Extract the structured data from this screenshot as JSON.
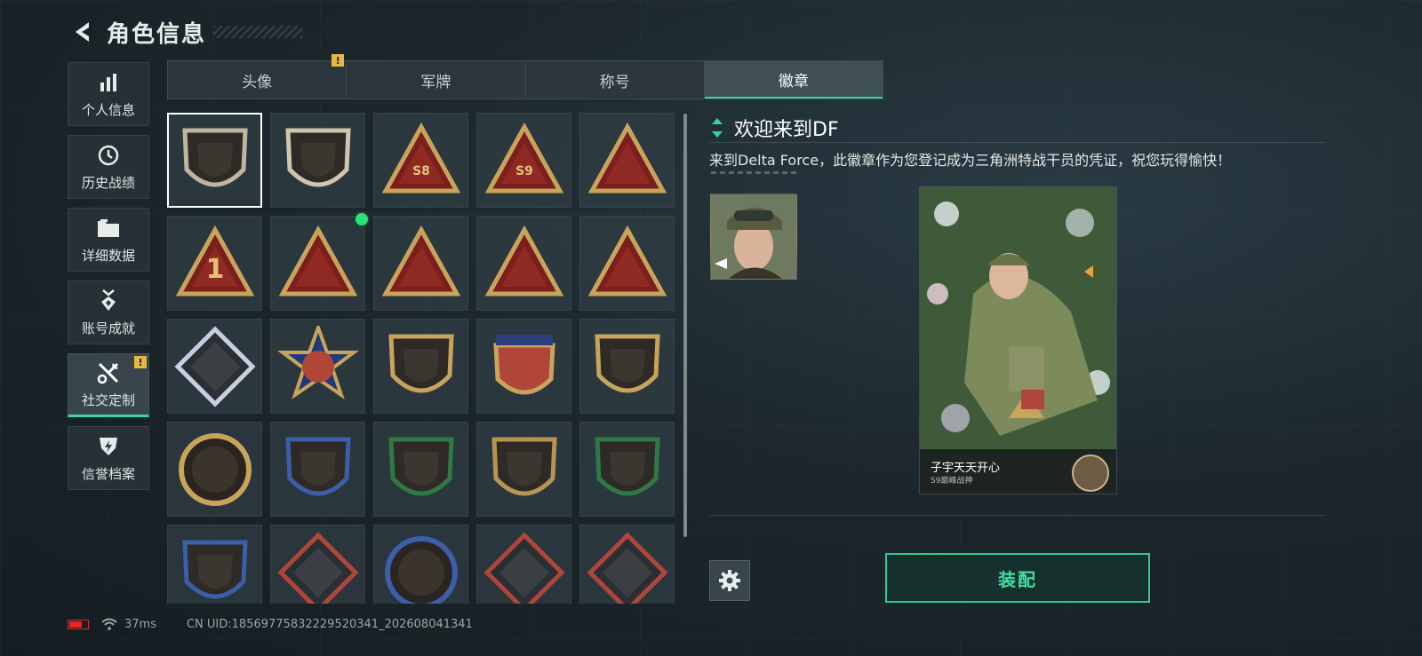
{
  "header": {
    "title": "角色信息"
  },
  "sidebar": {
    "items": [
      {
        "label": "个人信息",
        "icon": "bar-chart-icon"
      },
      {
        "label": "历史战绩",
        "icon": "clock-icon"
      },
      {
        "label": "详细数据",
        "icon": "folder-icon"
      },
      {
        "label": "账号成就",
        "icon": "medal-icon"
      },
      {
        "label": "社交定制",
        "icon": "tools-icon",
        "active": true,
        "alert": "!"
      },
      {
        "label": "信誉档案",
        "icon": "shield-bolt-icon"
      }
    ]
  },
  "tabs": [
    {
      "label": "头像",
      "alert": "!"
    },
    {
      "label": "军牌"
    },
    {
      "label": "称号"
    },
    {
      "label": "徽章",
      "active": true
    }
  ],
  "badges": [
    {
      "name": "delta-shield-badge",
      "shape": "shield",
      "color": "#bfb6a0",
      "selected": true
    },
    {
      "name": "helicopter-badge",
      "shape": "shield",
      "color": "#cfc6b0"
    },
    {
      "name": "s8-badge",
      "shape": "triangle",
      "color": "#c8a45a",
      "label": "S8"
    },
    {
      "name": "s9-badge",
      "shape": "triangle",
      "color": "#c8a45a",
      "label": "S9"
    },
    {
      "name": "nest-badge",
      "shape": "triangle",
      "color": "#c8a45a"
    },
    {
      "name": "rank-one-badge",
      "shape": "triangle",
      "color": "#c8a45a",
      "label": "1"
    },
    {
      "name": "usb-badge",
      "shape": "triangle",
      "color": "#c8a45a",
      "new": true
    },
    {
      "name": "soldiers-badge",
      "shape": "triangle",
      "color": "#c8a45a"
    },
    {
      "name": "rocket-badge",
      "shape": "triangle",
      "color": "#c8a45a"
    },
    {
      "name": "fish-badge",
      "shape": "triangle",
      "color": "#c8a45a"
    },
    {
      "name": "rose-badge",
      "shape": "diamond",
      "color": "#c9cfe0"
    },
    {
      "name": "star-skull-badge",
      "shape": "star",
      "color": "#c8a45a"
    },
    {
      "name": "chevron-shield-badge",
      "shape": "shield",
      "color": "#c8a45a"
    },
    {
      "name": "stars-crest-badge",
      "shape": "crest",
      "color": "#c94a3a"
    },
    {
      "name": "gem-shield-badge",
      "shape": "shield",
      "color": "#c8a45a"
    },
    {
      "name": "gear-seal-badge",
      "shape": "circle",
      "color": "#c8a45a"
    },
    {
      "name": "rifle-blue-badge",
      "shape": "shield",
      "color": "#3d5ea8"
    },
    {
      "name": "rifle-green-badge",
      "shape": "shield",
      "color": "#2f7a44"
    },
    {
      "name": "rifle-bronze-badge",
      "shape": "shield",
      "color": "#b89452"
    },
    {
      "name": "sniper-green-badge",
      "shape": "shield",
      "color": "#2f7a44"
    },
    {
      "name": "knife-blue-badge",
      "shape": "shield",
      "color": "#3d5ea8"
    },
    {
      "name": "wolf-badge",
      "shape": "diamond",
      "color": "#b0453a"
    },
    {
      "name": "eagle-badge",
      "shape": "circle",
      "color": "#3d5ea8"
    },
    {
      "name": "dragon-badge",
      "shape": "diamond",
      "color": "#b0453a"
    },
    {
      "name": "runner-badge",
      "shape": "diamond",
      "color": "#b0453a"
    }
  ],
  "detail": {
    "title": "欢迎来到DF",
    "description": "来到Delta Force，此徽章作为您登记成为三角洲特战干员的凭证，祝您玩得愉快！",
    "card_name": "子宇天天开心",
    "card_subtitle": "S9巅峰战神"
  },
  "actions": {
    "equip_label": "装配"
  },
  "status": {
    "ping": "37ms",
    "uid": "CN UID:1856977583222952034​1_202608041341"
  },
  "colors": {
    "accent": "#35d6a0",
    "warning": "#e5b842",
    "new_dot": "#2fe07c"
  }
}
